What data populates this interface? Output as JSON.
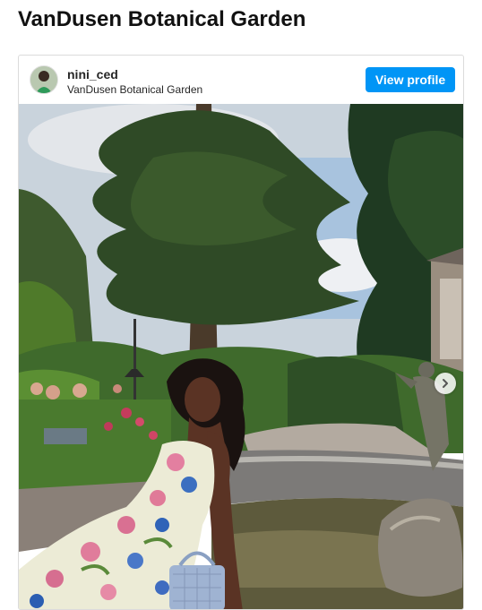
{
  "page": {
    "title": "VanDusen Botanical Garden"
  },
  "post": {
    "username": "nini_ced",
    "location": "VanDusen Botanical Garden",
    "view_profile_label": "View profile"
  },
  "icons": {
    "next": "chevron-right-icon",
    "avatar": "avatar"
  },
  "colors": {
    "button": "#0095f6",
    "border": "#dbdbdb"
  }
}
